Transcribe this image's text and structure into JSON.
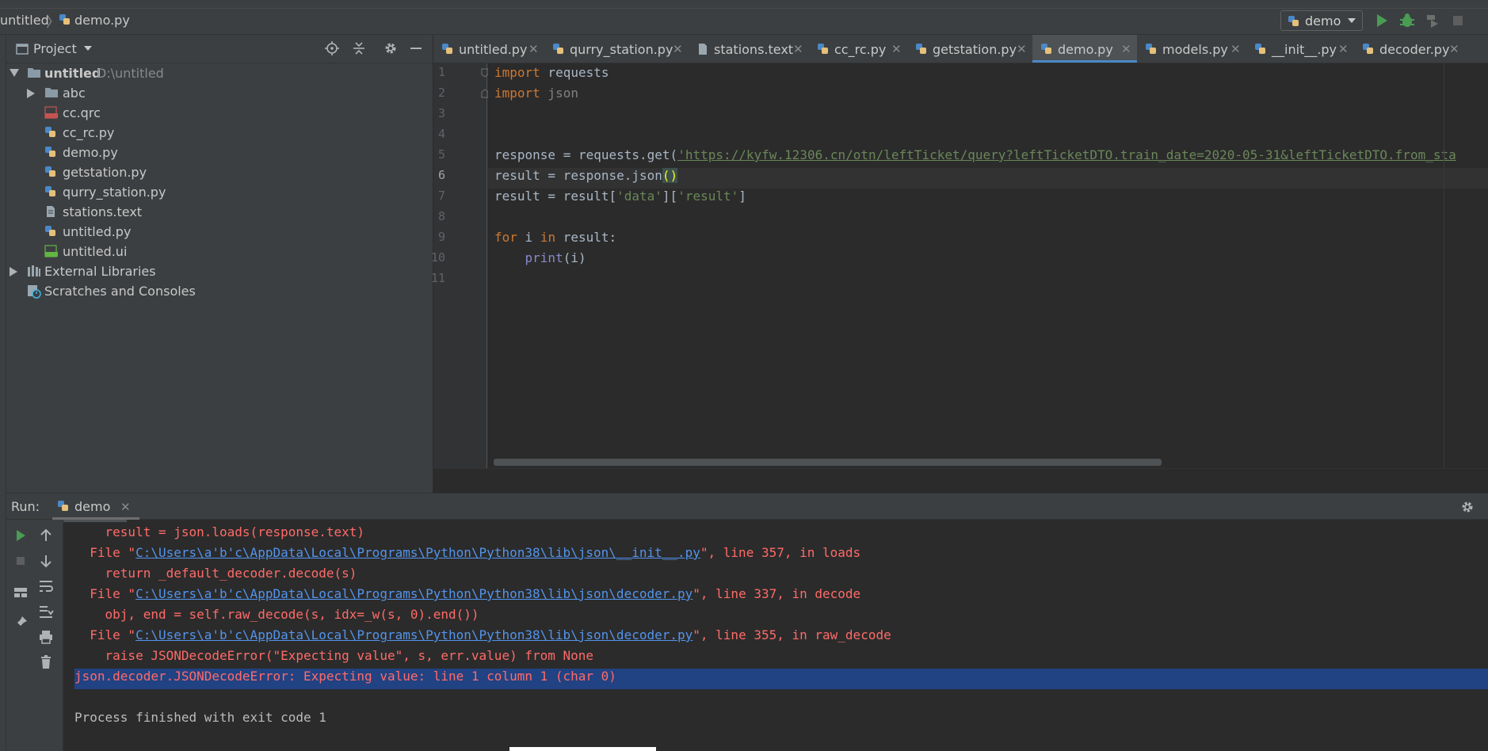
{
  "navbar": {
    "project": "untitled",
    "file": "demo.py",
    "run_config": "demo"
  },
  "project_panel": {
    "title": "Project",
    "root": {
      "name": "untitled",
      "path": "D:\\untitled"
    },
    "items": [
      {
        "label": "abc",
        "type": "folder"
      },
      {
        "label": "cc.qrc",
        "type": "qrc"
      },
      {
        "label": "cc_rc.py",
        "type": "python"
      },
      {
        "label": "demo.py",
        "type": "python"
      },
      {
        "label": "getstation.py",
        "type": "python"
      },
      {
        "label": "qurry_station.py",
        "type": "python"
      },
      {
        "label": "stations.text",
        "type": "text"
      },
      {
        "label": "untitled.py",
        "type": "python"
      },
      {
        "label": "untitled.ui",
        "type": "ui"
      }
    ],
    "external_libraries": "External Libraries",
    "scratches": "Scratches and Consoles"
  },
  "tabs": [
    {
      "label": "untitled.py"
    },
    {
      "label": "qurry_station.py"
    },
    {
      "label": "stations.text"
    },
    {
      "label": "cc_rc.py"
    },
    {
      "label": "getstation.py"
    },
    {
      "label": "demo.py",
      "active": true
    },
    {
      "label": "models.py"
    },
    {
      "label": "__init__.py"
    },
    {
      "label": "decoder.py"
    }
  ],
  "editor": {
    "line_numbers": [
      "1",
      "2",
      "3",
      "4",
      "5",
      "6",
      "7",
      "8",
      "9",
      "10",
      "11"
    ],
    "current_line": 6,
    "lines": {
      "l1": {
        "kw": "import",
        "rest": " requests"
      },
      "l2": {
        "kw": "import",
        "rest": " json"
      },
      "l5": {
        "pre": "response = requests.get(",
        "url": "'https://kyfw.12306.cn/otn/leftTicket/query?leftTicketDTO.train_date=2020-05-31&leftTicketDTO.from_sta"
      },
      "l6": {
        "pre": "result = response.json",
        "paren": "()"
      },
      "l7": {
        "pre": "result = result[",
        "s1": "'data'",
        "mid": "][",
        "s2": "'result'",
        "post": "]"
      },
      "l9": {
        "kw1": "for",
        "mid": " i ",
        "kw2": "in",
        "post": " result:"
      },
      "l10": {
        "indent": "    ",
        "fn": "print",
        "post": "(i)"
      }
    }
  },
  "run_panel": {
    "label": "Run:",
    "tab": "demo",
    "console": {
      "c1": "    result = json.loads(response.text)",
      "c2": {
        "pre": "  File \"",
        "link": "C:\\Users\\a'b'c\\AppData\\Local\\Programs\\Python\\Python38\\lib\\json\\__init__.py",
        "post": "\", line 357, in loads"
      },
      "c3": "    return _default_decoder.decode(s)",
      "c4": {
        "pre": "  File \"",
        "link": "C:\\Users\\a'b'c\\AppData\\Local\\Programs\\Python\\Python38\\lib\\json\\decoder.py",
        "post": "\", line 337, in decode"
      },
      "c5": "    obj, end = self.raw_decode(s, idx=_w(s, 0).end())",
      "c6": {
        "pre": "  File \"",
        "link": "C:\\Users\\a'b'c\\AppData\\Local\\Programs\\Python\\Python38\\lib\\json\\decoder.py",
        "post": "\", line 355, in raw_decode"
      },
      "c7": "    raise JSONDecodeError(\"Expecting value\", s, err.value) from None",
      "c8": "json.decoder.JSONDecodeError: Expecting value: line 1 column 1 (char 0)",
      "c9": "Process finished with exit code 1"
    }
  },
  "colors": {
    "accent": "#4a88c7",
    "error": "#ff6b68",
    "link": "#5394ec",
    "run_green": "#499c54"
  }
}
